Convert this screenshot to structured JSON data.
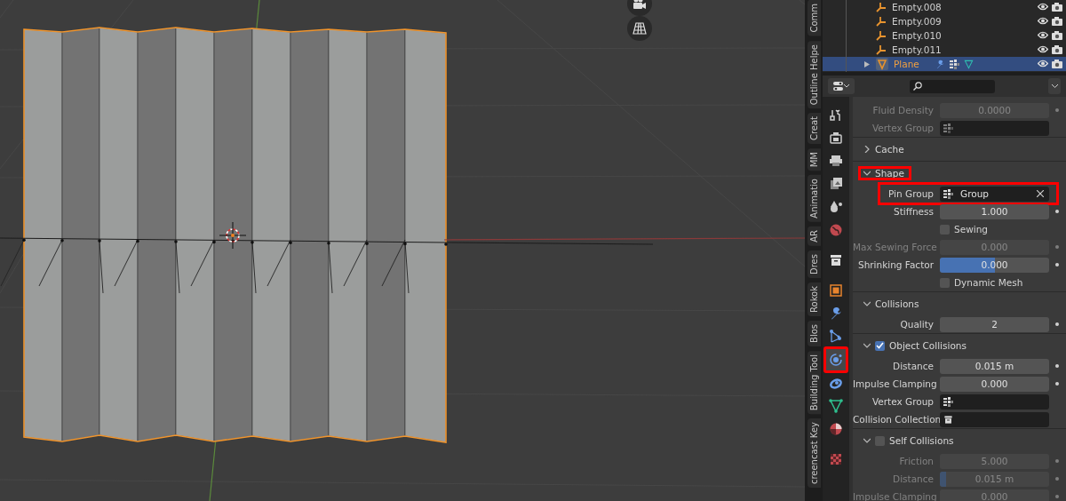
{
  "side_tabs": [
    {
      "label": "Comm"
    },
    {
      "label": "Outline Helpe"
    },
    {
      "label": "Creat"
    },
    {
      "label": "MM"
    },
    {
      "label": "Animatio"
    },
    {
      "label": "AR"
    },
    {
      "label": "Dres"
    },
    {
      "label": "Rokok"
    },
    {
      "label": "Blos"
    },
    {
      "label": "Building Tool"
    },
    {
      "label": "creencast Key"
    }
  ],
  "outliner": {
    "items": [
      {
        "name": "Empty.008",
        "kind": "empty",
        "selected": false
      },
      {
        "name": "Empty.009",
        "kind": "empty",
        "selected": false
      },
      {
        "name": "Empty.010",
        "kind": "empty",
        "selected": false
      },
      {
        "name": "Empty.011",
        "kind": "empty",
        "selected": false
      },
      {
        "name": "Plane",
        "kind": "mesh",
        "selected": true
      }
    ]
  },
  "properties": {
    "tabs": [
      {
        "kind": "tool",
        "selected": false,
        "annotated": false
      },
      {
        "kind": "render",
        "selected": false,
        "annotated": false
      },
      {
        "kind": "output",
        "selected": false,
        "annotated": false
      },
      {
        "kind": "view_layer",
        "selected": false,
        "annotated": false
      },
      {
        "kind": "scene",
        "selected": false,
        "annotated": false
      },
      {
        "kind": "world",
        "selected": false,
        "annotated": false
      },
      {
        "kind": "collection",
        "selected": false,
        "annotated": false
      },
      {
        "kind": "object",
        "selected": false,
        "annotated": false
      },
      {
        "kind": "modifier",
        "selected": false,
        "annotated": false
      },
      {
        "kind": "particles",
        "selected": false,
        "annotated": false
      },
      {
        "kind": "physics",
        "selected": true,
        "annotated": true
      },
      {
        "kind": "constraints",
        "selected": false,
        "annotated": false
      },
      {
        "kind": "data",
        "selected": false,
        "annotated": false
      },
      {
        "kind": "material",
        "selected": false,
        "annotated": false
      },
      {
        "kind": "texture",
        "selected": false,
        "annotated": false
      }
    ],
    "rows": [
      {
        "kind": "field",
        "label": "Fluid Density",
        "value": "0.0000",
        "disabled": true
      },
      {
        "kind": "vgroup",
        "label": "Vertex Group",
        "disabled": true,
        "annotated": false
      },
      {
        "kind": "panel",
        "label": "Cache",
        "expanded": false,
        "annotated": false
      },
      {
        "kind": "panel",
        "label": "Shape",
        "expanded": true,
        "annotated": true
      },
      {
        "kind": "vgroup",
        "label": "Pin Group",
        "value": "Group",
        "disabled": false,
        "annotated": true
      },
      {
        "kind": "field",
        "label": "Stiffness",
        "value": "1.000",
        "disabled": false
      },
      {
        "kind": "checkbox",
        "label": "Sewing",
        "checked": false
      },
      {
        "kind": "field",
        "label": "Max Sewing Force",
        "value": "0.000",
        "disabled": true
      },
      {
        "kind": "slider",
        "label": "Shrinking Factor",
        "value": "0.000",
        "level": 0.5,
        "disabled": false
      },
      {
        "kind": "checkbox",
        "label": "Dynamic Mesh",
        "checked": false
      },
      {
        "kind": "panel",
        "label": "Collisions",
        "expanded": true,
        "annotated": false
      },
      {
        "kind": "field",
        "label": "Quality",
        "value": "2",
        "disabled": false
      },
      {
        "kind": "panel",
        "label": "Object Collisions",
        "expanded": true,
        "checked": true,
        "annotated": false
      },
      {
        "kind": "field",
        "label": "Distance",
        "value": "0.015 m",
        "disabled": false
      },
      {
        "kind": "field",
        "label": "Impulse Clamping",
        "value": "0.000",
        "disabled": false
      },
      {
        "kind": "vgroup",
        "label": "Vertex Group",
        "disabled": false,
        "annotated": false
      },
      {
        "kind": "collection",
        "label": "Collision Collection"
      },
      {
        "kind": "panel",
        "label": "Self Collisions",
        "expanded": true,
        "checked": false,
        "annotated": false
      },
      {
        "kind": "field",
        "label": "Friction",
        "value": "5.000",
        "disabled": true
      },
      {
        "kind": "slider",
        "label": "Distance",
        "value": "0.015 m",
        "level": 0.06,
        "disabled": true
      },
      {
        "kind": "field",
        "label": "Impulse Clamping",
        "value": "0.000",
        "disabled": true
      }
    ]
  }
}
